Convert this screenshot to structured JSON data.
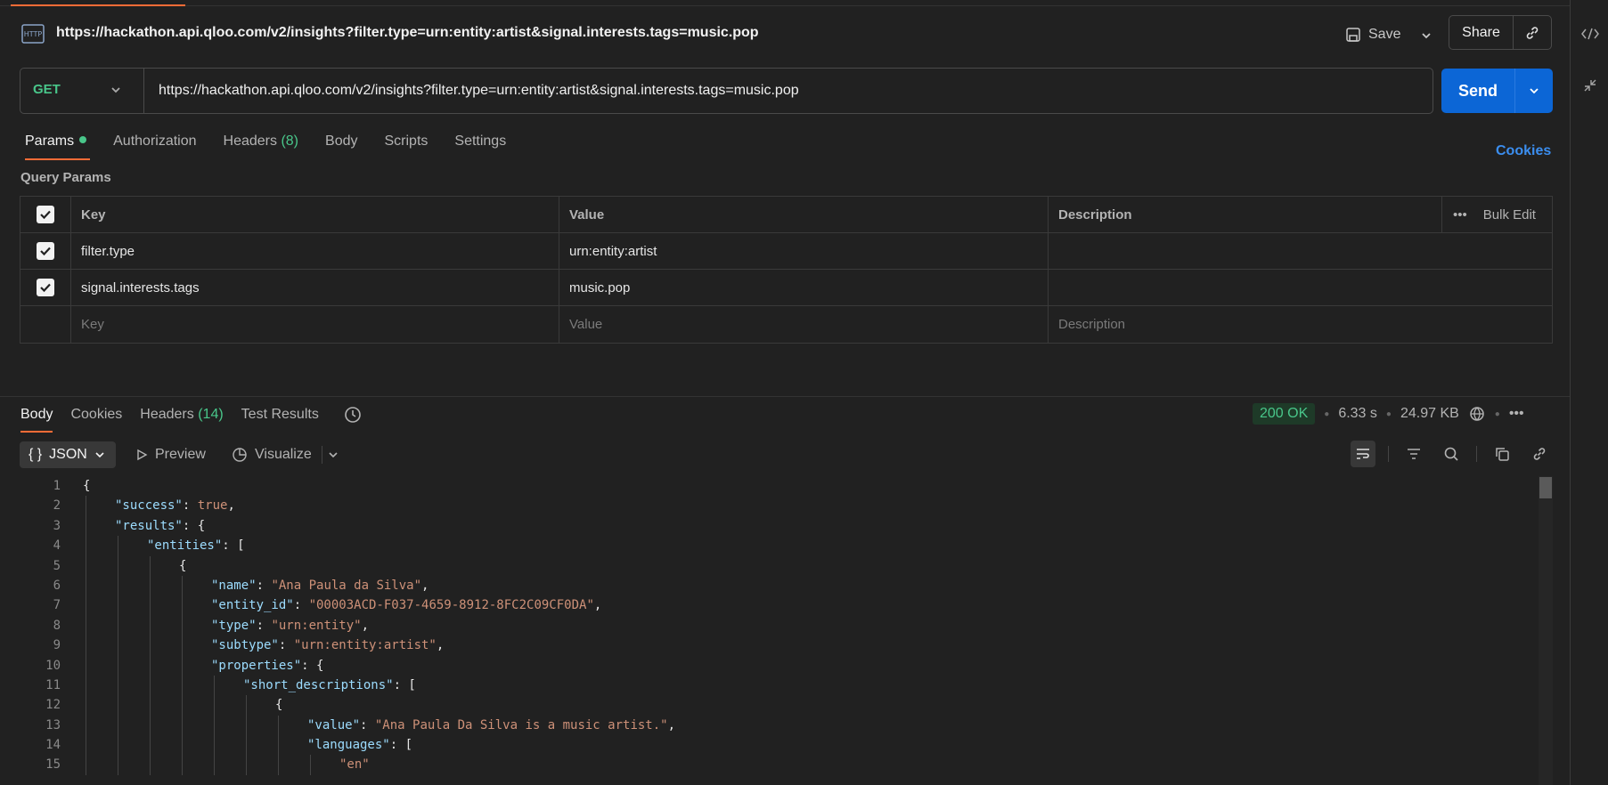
{
  "request": {
    "title": "https://hackathon.api.qloo.com/v2/insights?filter.type=urn:entity:artist&signal.interests.tags=music.pop",
    "method": "GET",
    "url": "https://hackathon.api.qloo.com/v2/insights?filter.type=urn:entity:artist&signal.interests.tags=music.pop",
    "save_label": "Save",
    "share_label": "Share",
    "send_label": "Send"
  },
  "request_tabs": {
    "params": "Params",
    "authorization": "Authorization",
    "headers": "Headers",
    "headers_count": "(8)",
    "body": "Body",
    "scripts": "Scripts",
    "settings": "Settings",
    "cookies": "Cookies"
  },
  "query_params": {
    "title": "Query Params",
    "columns": {
      "key": "Key",
      "value": "Value",
      "description": "Description"
    },
    "bulk_edit": "Bulk Edit",
    "rows": [
      {
        "key": "filter.type",
        "value": "urn:entity:artist",
        "description": ""
      },
      {
        "key": "signal.interests.tags",
        "value": "music.pop",
        "description": ""
      }
    ],
    "placeholders": {
      "key": "Key",
      "value": "Value",
      "description": "Description"
    }
  },
  "response": {
    "tabs": {
      "body": "Body",
      "cookies": "Cookies",
      "headers": "Headers",
      "headers_count": "(14)",
      "test_results": "Test Results"
    },
    "status": "200 OK",
    "time": "6.33 s",
    "size": "24.97 KB",
    "format": "JSON",
    "preview": "Preview",
    "visualize": "Visualize"
  },
  "code_lines": [
    {
      "n": "1",
      "indent": 0,
      "parts": [
        [
          "p",
          "{"
        ]
      ]
    },
    {
      "n": "2",
      "indent": 1,
      "parts": [
        [
          "k",
          "\"success\""
        ],
        [
          "p",
          ": "
        ],
        [
          "b",
          "true"
        ],
        [
          "p",
          ","
        ]
      ]
    },
    {
      "n": "3",
      "indent": 1,
      "parts": [
        [
          "k",
          "\"results\""
        ],
        [
          "p",
          ": {"
        ]
      ]
    },
    {
      "n": "4",
      "indent": 2,
      "parts": [
        [
          "k",
          "\"entities\""
        ],
        [
          "p",
          ": ["
        ]
      ]
    },
    {
      "n": "5",
      "indent": 3,
      "parts": [
        [
          "p",
          "{"
        ]
      ]
    },
    {
      "n": "6",
      "indent": 4,
      "parts": [
        [
          "k",
          "\"name\""
        ],
        [
          "p",
          ": "
        ],
        [
          "s",
          "\"Ana Paula da Silva\""
        ],
        [
          "p",
          ","
        ]
      ]
    },
    {
      "n": "7",
      "indent": 4,
      "parts": [
        [
          "k",
          "\"entity_id\""
        ],
        [
          "p",
          ": "
        ],
        [
          "s",
          "\"00003ACD-F037-4659-8912-8FC2C09CF0DA\""
        ],
        [
          "p",
          ","
        ]
      ]
    },
    {
      "n": "8",
      "indent": 4,
      "parts": [
        [
          "k",
          "\"type\""
        ],
        [
          "p",
          ": "
        ],
        [
          "s",
          "\"urn:entity\""
        ],
        [
          "p",
          ","
        ]
      ]
    },
    {
      "n": "9",
      "indent": 4,
      "parts": [
        [
          "k",
          "\"subtype\""
        ],
        [
          "p",
          ": "
        ],
        [
          "s",
          "\"urn:entity:artist\""
        ],
        [
          "p",
          ","
        ]
      ]
    },
    {
      "n": "10",
      "indent": 4,
      "parts": [
        [
          "k",
          "\"properties\""
        ],
        [
          "p",
          ": {"
        ]
      ]
    },
    {
      "n": "11",
      "indent": 5,
      "parts": [
        [
          "k",
          "\"short_descriptions\""
        ],
        [
          "p",
          ": ["
        ]
      ]
    },
    {
      "n": "12",
      "indent": 6,
      "parts": [
        [
          "p",
          "{"
        ]
      ]
    },
    {
      "n": "13",
      "indent": 7,
      "parts": [
        [
          "k",
          "\"value\""
        ],
        [
          "p",
          ": "
        ],
        [
          "s",
          "\"Ana Paula Da Silva is a music artist.\""
        ],
        [
          "p",
          ","
        ]
      ]
    },
    {
      "n": "14",
      "indent": 7,
      "parts": [
        [
          "k",
          "\"languages\""
        ],
        [
          "p",
          ": ["
        ]
      ]
    },
    {
      "n": "15",
      "indent": 8,
      "parts": [
        [
          "s",
          "\"en\""
        ]
      ]
    }
  ]
}
